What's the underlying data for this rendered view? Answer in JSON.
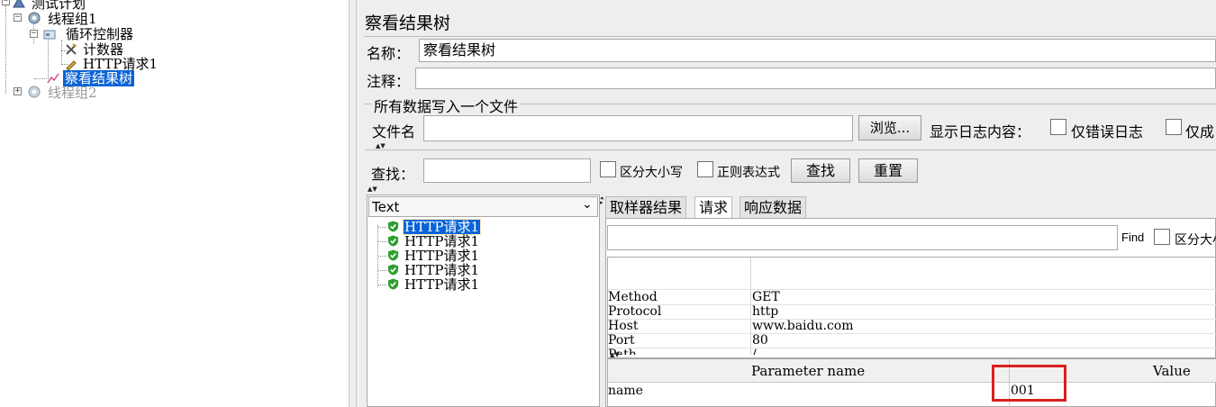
{
  "tree": {
    "nodes": [
      {
        "label": "测试计划"
      },
      {
        "label": "线程组1"
      },
      {
        "label": "循环控制器"
      },
      {
        "label": "计数器"
      },
      {
        "label": "HTTP请求1"
      },
      {
        "label": "察看结果树"
      },
      {
        "label": "线程组2"
      }
    ]
  },
  "panel": {
    "title": "察看结果树",
    "name_label": "名称：",
    "name_value": "察看结果树",
    "comment_label": "注释：",
    "comment_value": "",
    "file_group_title": "所有数据写入一个文件",
    "filename_label": "文件名",
    "filename_value": "",
    "browse_button": "浏览...",
    "log_label": "显示日志内容：",
    "errors_only": "仅错误日志",
    "success_only": "仅成"
  },
  "search": {
    "label": "查找：",
    "value": "",
    "case_sensitive": "区分大小写",
    "regex": "正则表达式",
    "find_button": "查找",
    "reset_button": "重置"
  },
  "results": {
    "renderer": "Text",
    "items": [
      "HTTP请求1",
      "HTTP请求1",
      "HTTP请求1",
      "HTTP请求1",
      "HTTP请求1"
    ]
  },
  "detail": {
    "tabs": [
      "取样器结果",
      "请求",
      "响应数据"
    ],
    "active_tab": "请求",
    "find_label": "Find",
    "find_case": "区分大小",
    "request_rows": [
      {
        "k": "Method",
        "v": "GET"
      },
      {
        "k": "Protocol",
        "v": "http"
      },
      {
        "k": "Host",
        "v": "www.baidu.com"
      },
      {
        "k": "Port",
        "v": "80"
      },
      {
        "k": "Path",
        "v": "/"
      }
    ],
    "param_headers": [
      "Parameter name",
      "Value"
    ],
    "params": [
      {
        "name": "name",
        "value": "001"
      }
    ],
    "highlight_color": "#d9201f"
  },
  "colors": {
    "selection": "#0a64d6",
    "panel_bg": "#eeeeee",
    "check_green": "#2e9e2e"
  }
}
